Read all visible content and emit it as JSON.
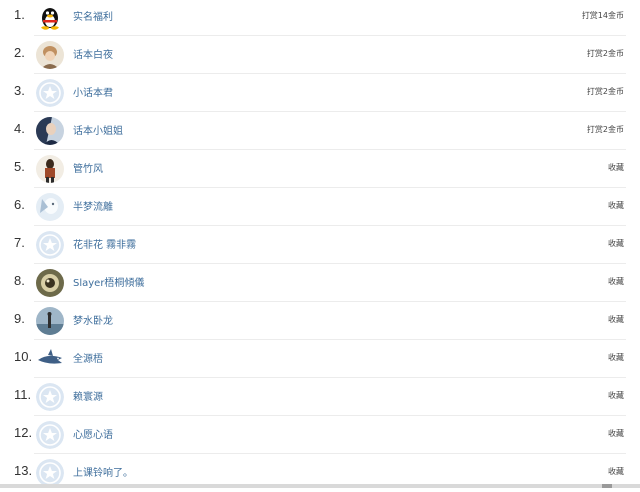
{
  "reward_list": {
    "items": [
      {
        "rank": "1.",
        "name": "实名福利",
        "action": "打赏14金币",
        "avatar_icon": "penguin-avatar-icon"
      },
      {
        "rank": "2.",
        "name": "话本白夜",
        "action": "打赏2金币",
        "avatar_icon": "photo-avatar-icon"
      },
      {
        "rank": "3.",
        "name": "小话本君",
        "action": "打赏2金币",
        "avatar_icon": "default-star-avatar-icon"
      },
      {
        "rank": "4.",
        "name": "话本小姐姐",
        "action": "打赏2金币",
        "avatar_icon": "photo-avatar-icon"
      },
      {
        "rank": "5.",
        "name": "管竹风",
        "action": "收藏",
        "avatar_icon": "photo-avatar-icon"
      },
      {
        "rank": "6.",
        "name": "半梦流離",
        "action": "收藏",
        "avatar_icon": "photo-avatar-icon"
      },
      {
        "rank": "7.",
        "name": "花非花 霧非霧",
        "action": "收藏",
        "avatar_icon": "default-star-avatar-icon"
      },
      {
        "rank": "8.",
        "name": "Slayer梧桐傾儀",
        "action": "收藏",
        "avatar_icon": "photo-avatar-icon"
      },
      {
        "rank": "9.",
        "name": "梦水卧龙",
        "action": "收藏",
        "avatar_icon": "photo-avatar-icon"
      },
      {
        "rank": "10.",
        "name": "全源梧",
        "action": "收藏",
        "avatar_icon": "shark-avatar-icon"
      },
      {
        "rank": "11.",
        "name": "赖寰源",
        "action": "收藏",
        "avatar_icon": "default-star-avatar-icon"
      },
      {
        "rank": "12.",
        "name": "心愿心语",
        "action": "收藏",
        "avatar_icon": "default-star-avatar-icon"
      },
      {
        "rank": "13.",
        "name": "上课铃响了。",
        "action": "收藏",
        "avatar_icon": "default-star-avatar-icon"
      }
    ]
  },
  "colors": {
    "name_link": "#3e6e9c",
    "default_avatar_bg": "#dbe6f2",
    "divider": "#ececec"
  }
}
